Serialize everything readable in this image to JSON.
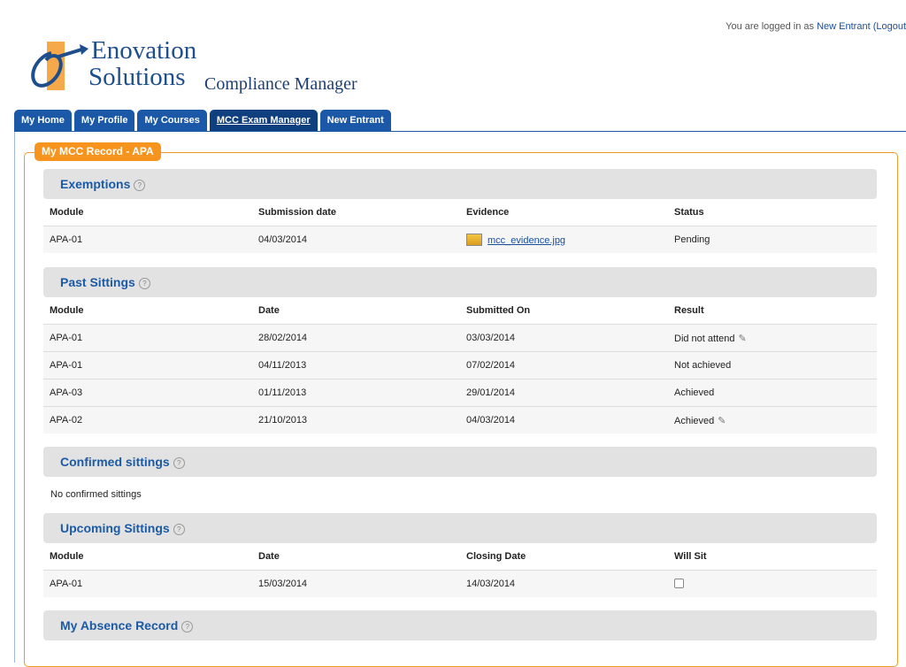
{
  "header": {
    "login_prefix": "You are logged in as",
    "user": "New Entrant",
    "logout": "(Logout"
  },
  "logo": {
    "line1": "Enovation",
    "line2": "Solutions",
    "product": "Compliance Manager"
  },
  "tabs": [
    "My Home",
    "My Profile",
    "My Courses",
    "MCC Exam Manager",
    "New Entrant"
  ],
  "record_title": "My MCC Record - APA",
  "sections": {
    "exemptions": {
      "title": "Exemptions",
      "headers": [
        "Module",
        "Submission date",
        "Evidence",
        "Status"
      ],
      "rows": [
        {
          "module": "APA-01",
          "date": "04/03/2014",
          "evidence": "mcc_evidence.jpg",
          "status": "Pending"
        }
      ]
    },
    "past_sittings": {
      "title": "Past Sittings",
      "headers": [
        "Module",
        "Date",
        "Submitted On",
        "Result"
      ],
      "rows": [
        {
          "module": "APA-01",
          "date": "28/02/2014",
          "submitted": "03/03/2014",
          "result": "Did not attend"
        },
        {
          "module": "APA-01",
          "date": "04/11/2013",
          "submitted": "07/02/2014",
          "result": "Not achieved"
        },
        {
          "module": "APA-03",
          "date": "01/11/2013",
          "submitted": "29/01/2014",
          "result": "Achieved"
        },
        {
          "module": "APA-02",
          "date": "21/10/2013",
          "submitted": "04/03/2014",
          "result": "Achieved"
        }
      ]
    },
    "confirmed": {
      "title": "Confirmed sittings",
      "empty": "No confirmed sittings"
    },
    "upcoming": {
      "title": "Upcoming Sittings",
      "headers": [
        "Module",
        "Date",
        "Closing Date",
        "Will Sit"
      ],
      "rows": [
        {
          "module": "APA-01",
          "date": "15/03/2014",
          "closing": "14/03/2014",
          "will_sit": false
        }
      ]
    },
    "absence": {
      "title": "My Absence Record"
    }
  },
  "colors": {
    "brand_blue": "#1b58a8",
    "accent_orange": "#f7941d",
    "section_bg": "#e2e2e2"
  }
}
